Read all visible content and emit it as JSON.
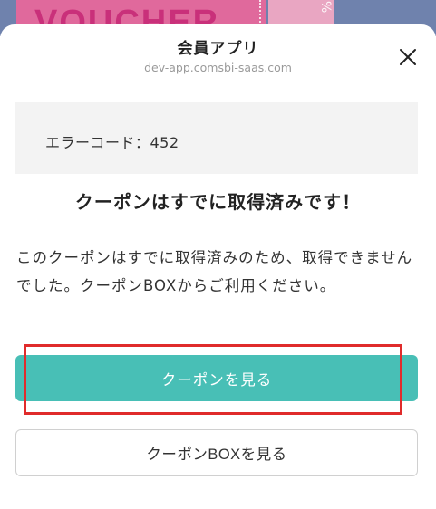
{
  "background": {
    "banner_text": "VOUCHER",
    "stub_text": "%"
  },
  "modal": {
    "title": "会員アプリ",
    "domain": "dev-app.comsbi-saas.com",
    "close_icon": "close-icon",
    "error_code_text": "エラーコード：452",
    "headline": "クーポンはすでに取得済みです！",
    "message": "このクーポンはすでに取得済みのため、取得できませんでした。クーポンBOXからご利用ください。",
    "primary_button_label": "クーポンを見る",
    "secondary_button_label": "クーポンBOXを見る"
  },
  "colors": {
    "accent": "#48bfb6",
    "highlight": "#e02b2b",
    "error_box": "#f3f3f3"
  }
}
